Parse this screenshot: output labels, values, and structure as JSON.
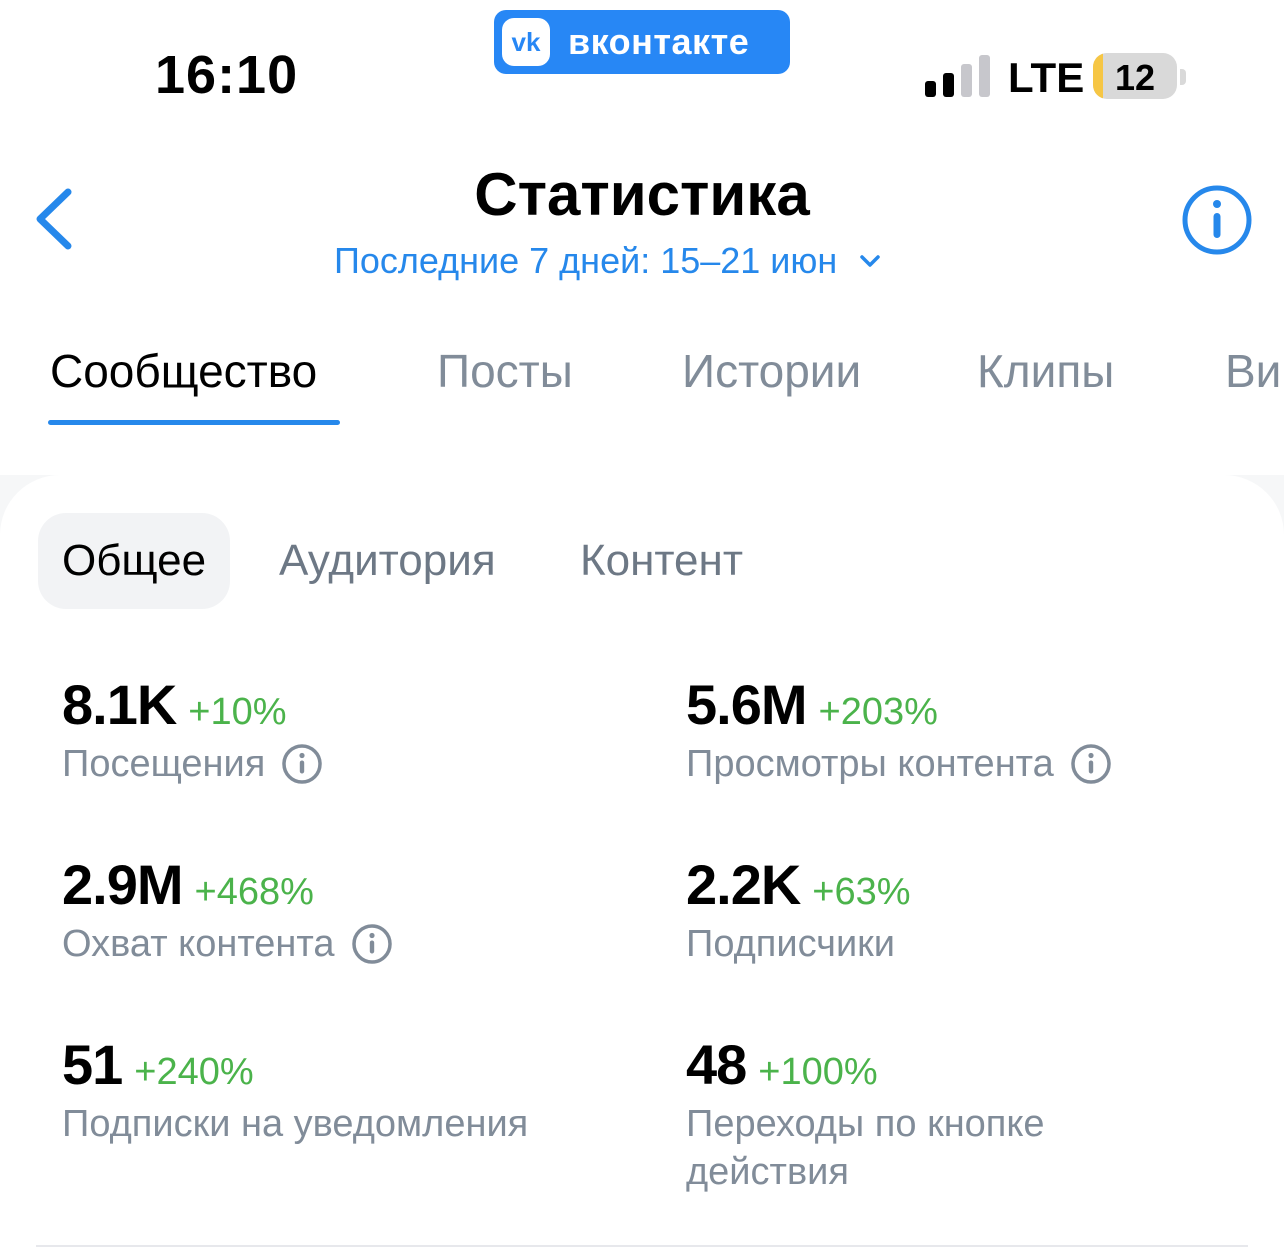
{
  "status_bar": {
    "time": "16:10",
    "app_badge": "вконтакте",
    "app_badge_logo": "vk",
    "network": "LTE",
    "battery": "12",
    "battery_level": 0.12
  },
  "header": {
    "title": "Статистика",
    "period": "Последние 7 дней: 15–21 июн"
  },
  "tabs": [
    {
      "label": "Сообщество",
      "active": true
    },
    {
      "label": "Посты",
      "active": false
    },
    {
      "label": "Истории",
      "active": false
    },
    {
      "label": "Клипы",
      "active": false
    },
    {
      "label": "Ви",
      "active": false
    }
  ],
  "segments": [
    {
      "label": "Общее",
      "active": true
    },
    {
      "label": "Аудитория",
      "active": false
    },
    {
      "label": "Контент",
      "active": false
    }
  ],
  "metrics": [
    {
      "value": "8.1K",
      "delta": "+10%",
      "label": "Посещения",
      "info": true
    },
    {
      "value": "5.6M",
      "delta": "+203%",
      "label": "Просмотры контента",
      "info": true
    },
    {
      "value": "2.9M",
      "delta": "+468%",
      "label": "Охват контента",
      "info": true
    },
    {
      "value": "2.2K",
      "delta": "+63%",
      "label": "Подписчики",
      "info": false
    },
    {
      "value": "51",
      "delta": "+240%",
      "label": "Подписки на уведомления",
      "info": false
    },
    {
      "value": "48",
      "delta": "+100%",
      "label": "Переходы по кнопке действия",
      "info": false
    }
  ],
  "colors": {
    "accent": "#2688eb",
    "positive": "#4bb34b",
    "secondary_text": "#818c99",
    "vk_brand": "#2787f5"
  }
}
